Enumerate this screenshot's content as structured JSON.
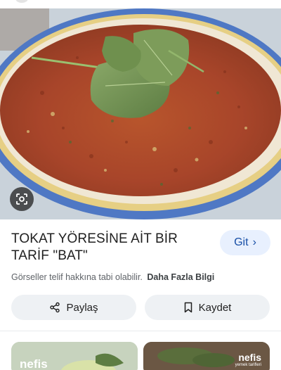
{
  "result": {
    "title": "TOKAT YÖRESİNE AİT BİR TARİF \"BAT\"",
    "visit_button": {
      "label": "Git",
      "icon": "chevron-right-icon"
    },
    "copyright_notice": "Görseller telif hakkına tabi olabilir.",
    "more_info_link": "Daha Fazla Bilgi",
    "share_button": {
      "label": "Paylaş",
      "icon": "share-icon"
    },
    "save_button": {
      "label": "Kaydet",
      "icon": "bookmark-icon"
    },
    "lens_button": {
      "icon": "lens-search-icon"
    }
  },
  "related": [
    {
      "brand": "nefis",
      "icon": "nefis-logo"
    },
    {
      "brand": "nefis",
      "sub": "yemek tarifleri",
      "icon": "nefis-logo"
    }
  ],
  "colors": {
    "accent_bg": "#e8f0fe",
    "accent_text": "#174ea6",
    "pill_bg": "#eef1f4",
    "muted_text": "#5f6368"
  }
}
